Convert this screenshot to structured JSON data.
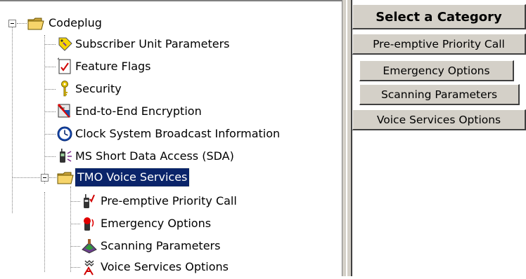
{
  "tree": {
    "root": {
      "label": "Codeplug",
      "icon": "open-folder-icon"
    },
    "items": [
      {
        "label": "Subscriber Unit Parameters",
        "icon": "tag-icon"
      },
      {
        "label": "Feature Flags",
        "icon": "checklist-icon"
      },
      {
        "label": "Security",
        "icon": "key-icon"
      },
      {
        "label": "End-to-End Encryption",
        "icon": "encryption-icon"
      },
      {
        "label": "Clock System Broadcast Information",
        "icon": "clock-icon"
      },
      {
        "label": "MS Short Data Access (SDA)",
        "icon": "radio-sda-icon"
      }
    ],
    "folder": {
      "label": "TMO Voice Services",
      "icon": "open-folder-icon",
      "selected": true
    },
    "subitems": [
      {
        "label": "Pre-emptive Priority Call",
        "icon": "radio-priority-icon"
      },
      {
        "label": "Emergency Options",
        "icon": "radio-emergency-icon"
      },
      {
        "label": "Scanning Parameters",
        "icon": "scanning-icon"
      },
      {
        "label": "Voice Services Options",
        "icon": "voice-services-icon"
      }
    ]
  },
  "category": {
    "header": "Select a Category",
    "buttons": [
      "Pre-emptive Priority Call",
      "Emergency Options",
      "Scanning Parameters",
      "Voice Services Options"
    ]
  },
  "colors": {
    "selection": "#0a246a",
    "button_face": "#d4d0c8",
    "tree_line": "#808080"
  }
}
